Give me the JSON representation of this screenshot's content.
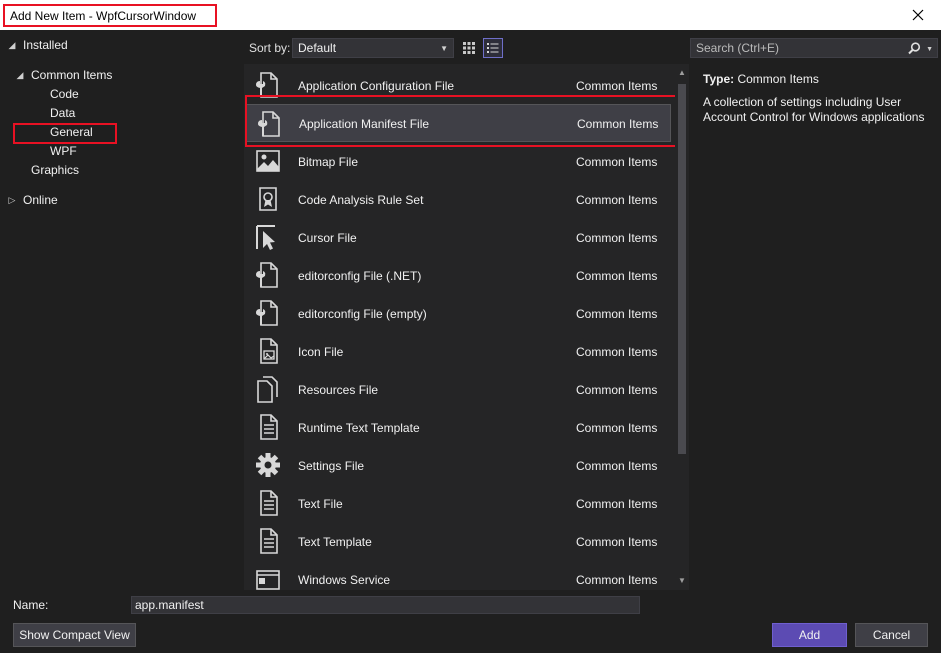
{
  "window": {
    "title": "Add New Item - WpfCursorWindow"
  },
  "tree": [
    {
      "label": "Installed",
      "expanded": true
    },
    {
      "label": "Common Items",
      "expanded": true
    },
    {
      "label": "Code"
    },
    {
      "label": "Data"
    },
    {
      "label": "General",
      "selected": true
    },
    {
      "label": "WPF"
    },
    {
      "label": "Graphics"
    },
    {
      "label": "Online",
      "expanded": false
    }
  ],
  "toolbar": {
    "sort_label": "Sort by:",
    "sort_value": "Default",
    "search_placeholder": "Search (Ctrl+E)"
  },
  "items": [
    {
      "name": "Application Configuration File",
      "category": "Common Items",
      "icon": "config-file-icon"
    },
    {
      "name": "Application Manifest File",
      "category": "Common Items",
      "icon": "manifest-file-icon",
      "selected": true
    },
    {
      "name": "Bitmap File",
      "category": "Common Items",
      "icon": "bitmap-file-icon"
    },
    {
      "name": "Code Analysis Rule Set",
      "category": "Common Items",
      "icon": "rule-set-icon"
    },
    {
      "name": "Cursor File",
      "category": "Common Items",
      "icon": "cursor-file-icon"
    },
    {
      "name": "editorconfig File (.NET)",
      "category": "Common Items",
      "icon": "editorconfig-file-icon"
    },
    {
      "name": "editorconfig File (empty)",
      "category": "Common Items",
      "icon": "editorconfig-file-icon"
    },
    {
      "name": "Icon File",
      "category": "Common Items",
      "icon": "icon-file-icon"
    },
    {
      "name": "Resources File",
      "category": "Common Items",
      "icon": "resources-file-icon"
    },
    {
      "name": "Runtime Text Template",
      "category": "Common Items",
      "icon": "text-template-icon"
    },
    {
      "name": "Settings File",
      "category": "Common Items",
      "icon": "gear-icon"
    },
    {
      "name": "Text File",
      "category": "Common Items",
      "icon": "text-file-icon"
    },
    {
      "name": "Text Template",
      "category": "Common Items",
      "icon": "text-template-icon"
    },
    {
      "name": "Windows Service",
      "category": "Common Items",
      "icon": "windows-service-icon"
    }
  ],
  "details": {
    "type_label": "Type:",
    "type_value": "Common Items",
    "description": "A collection of settings including User Account Control for Windows applications"
  },
  "footer": {
    "name_label": "Name:",
    "name_value": "app.manifest",
    "compact_label": "Show Compact View",
    "add_label": "Add",
    "cancel_label": "Cancel"
  },
  "colors": {
    "accent": "#5c4bb3",
    "highlight": "#e81123"
  }
}
